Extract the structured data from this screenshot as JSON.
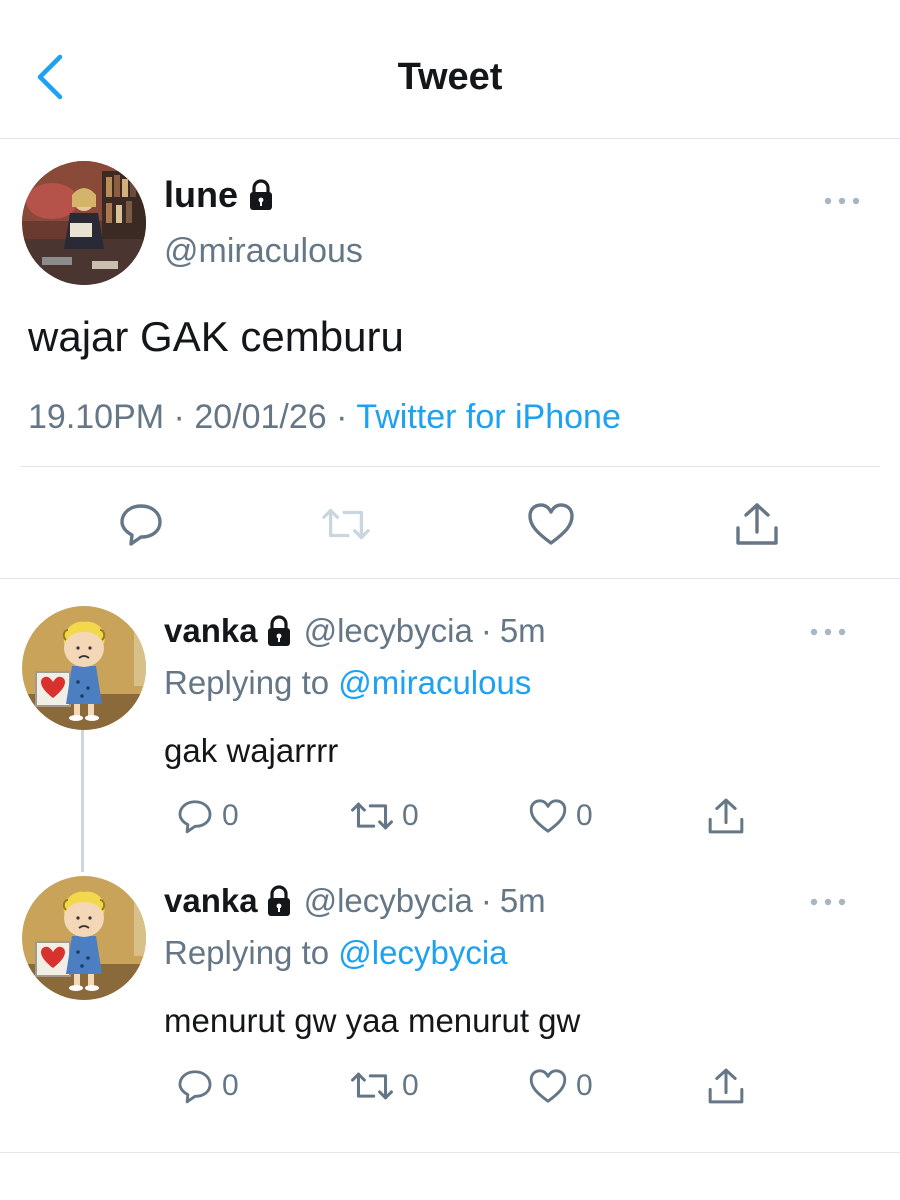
{
  "header": {
    "title": "Tweet"
  },
  "main_tweet": {
    "name": "lune",
    "handle": "@miraculous",
    "text": "wajar GAK cemburu",
    "time": "19.10PM",
    "date": "20/01/26",
    "source": "Twitter for iPhone",
    "separator": "·"
  },
  "replies": [
    {
      "name": "vanka",
      "handle": "@lecybycia",
      "separator": "·",
      "time": "5m",
      "replying_prefix": "Replying to",
      "replying_to": "@miraculous",
      "text": "gak wajarrrr",
      "reply_count": "0",
      "retweet_count": "0",
      "like_count": "0"
    },
    {
      "name": "vanka",
      "handle": "@lecybycia",
      "separator": "·",
      "time": "5m",
      "replying_prefix": "Replying to",
      "replying_to": "@lecybycia",
      "text": "menurut gw yaa menurut gw",
      "reply_count": "0",
      "retweet_count": "0",
      "like_count": "0"
    }
  ],
  "colors": {
    "link": "#1da1f2",
    "secondary_text": "#657786",
    "divider": "#e1e8ed",
    "disabled_icon": "#c9d6df"
  }
}
